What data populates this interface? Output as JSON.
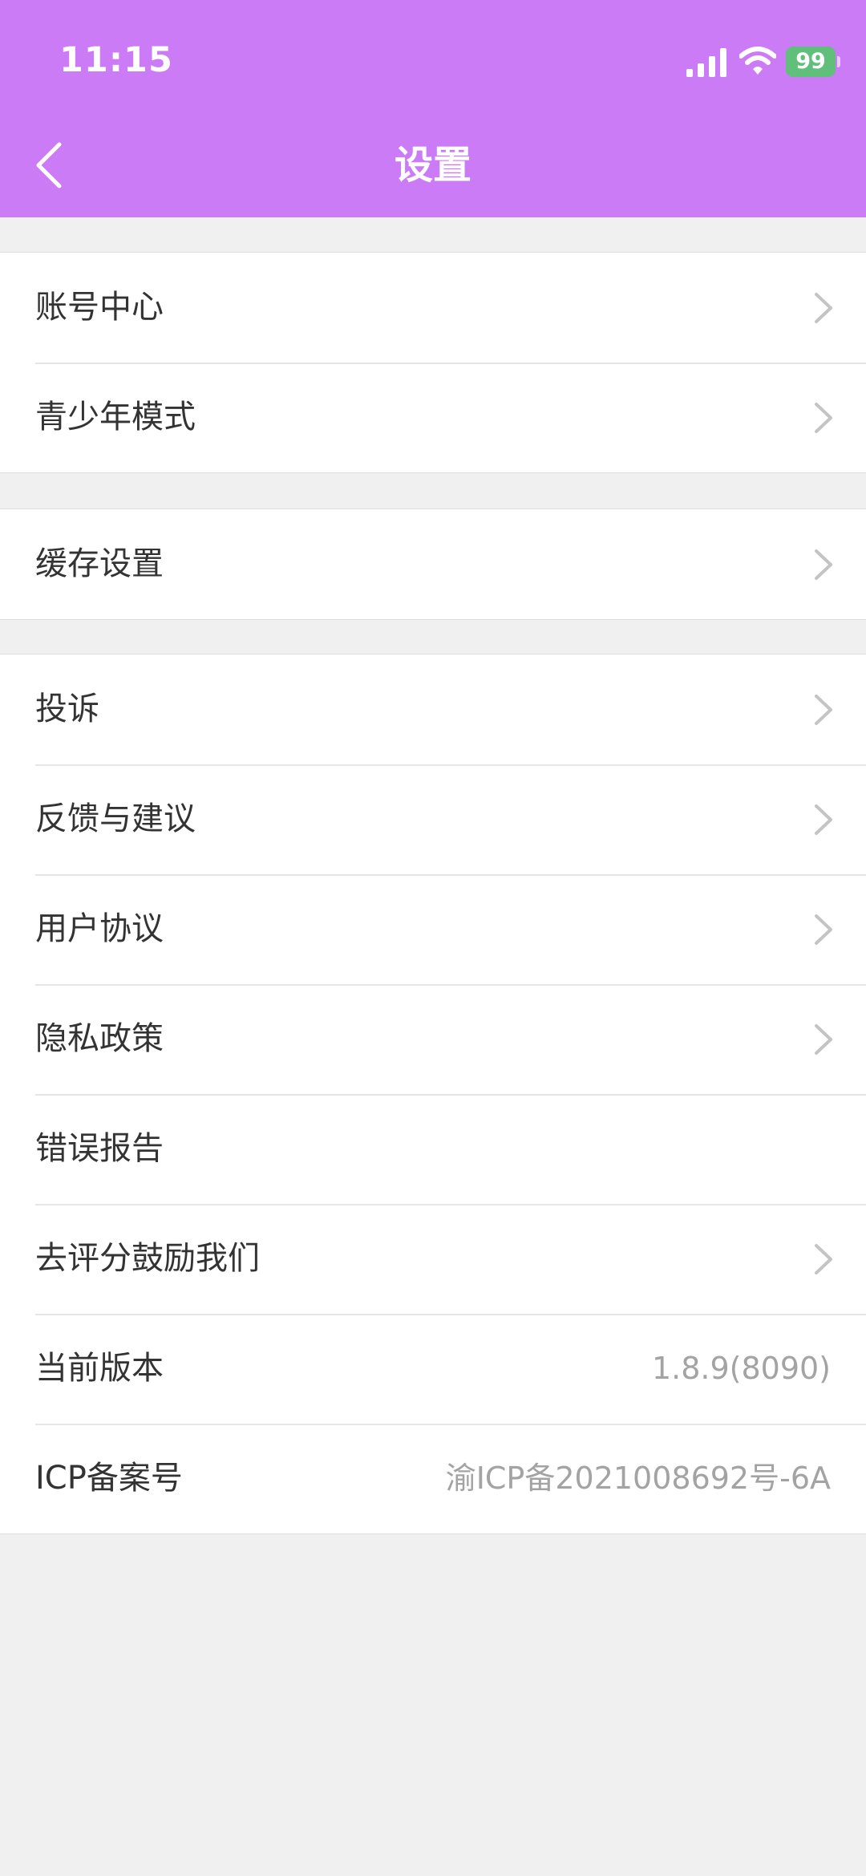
{
  "status_bar": {
    "time": "11:15",
    "battery": "99",
    "icons": [
      "signal-icon",
      "wifi-icon",
      "battery-icon"
    ],
    "battery_color": "#5fbf7b"
  },
  "header": {
    "title": "设置",
    "back_icon": "chevron-left-icon",
    "background_color": "#cc7bf6"
  },
  "groups": [
    {
      "items": [
        {
          "label": "账号中心",
          "chevron": true
        },
        {
          "label": "青少年模式",
          "chevron": true
        }
      ]
    },
    {
      "items": [
        {
          "label": "缓存设置",
          "chevron": true
        }
      ]
    },
    {
      "items": [
        {
          "label": "投诉",
          "chevron": true
        },
        {
          "label": "反馈与建议",
          "chevron": true
        },
        {
          "label": "用户协议",
          "chevron": true
        },
        {
          "label": "隐私政策",
          "chevron": true
        },
        {
          "label": "错误报告",
          "chevron": false
        },
        {
          "label": "去评分鼓励我们",
          "chevron": true
        },
        {
          "label": "当前版本",
          "value": "1.8.9(8090)",
          "chevron": false
        },
        {
          "label": "ICP备案号",
          "value": "渝ICP备2021008692号-6A",
          "chevron": false
        }
      ]
    }
  ]
}
